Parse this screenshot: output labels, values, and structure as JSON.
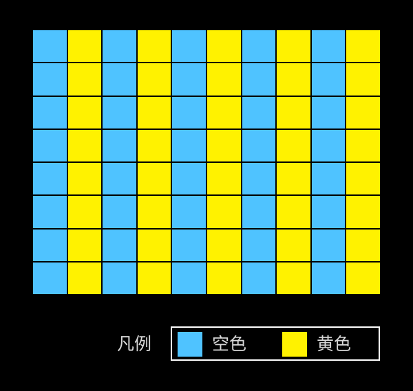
{
  "grid": {
    "rows": 8,
    "columns": 10,
    "cells": [
      [
        "empty",
        "yellow",
        "empty",
        "yellow",
        "empty",
        "yellow",
        "empty",
        "yellow",
        "empty",
        "yellow"
      ],
      [
        "empty",
        "yellow",
        "empty",
        "yellow",
        "empty",
        "yellow",
        "empty",
        "yellow",
        "empty",
        "yellow"
      ],
      [
        "empty",
        "yellow",
        "empty",
        "yellow",
        "empty",
        "yellow",
        "empty",
        "yellow",
        "empty",
        "yellow"
      ],
      [
        "empty",
        "yellow",
        "empty",
        "yellow",
        "empty",
        "yellow",
        "empty",
        "yellow",
        "empty",
        "yellow"
      ],
      [
        "empty",
        "yellow",
        "empty",
        "yellow",
        "empty",
        "yellow",
        "empty",
        "yellow",
        "empty",
        "yellow"
      ],
      [
        "empty",
        "yellow",
        "empty",
        "yellow",
        "empty",
        "yellow",
        "empty",
        "yellow",
        "empty",
        "yellow"
      ],
      [
        "empty",
        "yellow",
        "empty",
        "yellow",
        "empty",
        "yellow",
        "empty",
        "yellow",
        "empty",
        "yellow"
      ],
      [
        "empty",
        "yellow",
        "empty",
        "yellow",
        "empty",
        "yellow",
        "empty",
        "yellow",
        "empty",
        "yellow"
      ]
    ]
  },
  "colors": {
    "empty": "#4fc3ff",
    "yellow": "#fff200",
    "background": "#000000",
    "grid_lines": "#000000"
  },
  "legend": {
    "title": "凡例",
    "items": [
      {
        "key": "empty",
        "label": "空色"
      },
      {
        "key": "yellow",
        "label": "黄色"
      }
    ]
  }
}
